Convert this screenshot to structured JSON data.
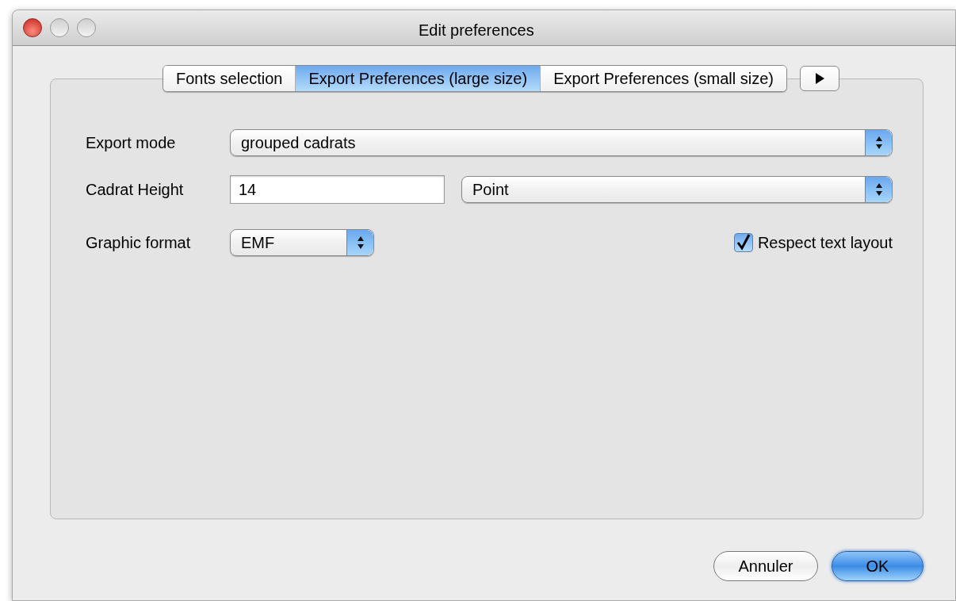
{
  "window": {
    "title": "Edit preferences"
  },
  "tabs": [
    {
      "label": "Fonts selection",
      "selected": false
    },
    {
      "label": "Export Preferences (large size)",
      "selected": true
    },
    {
      "label": "Export Preferences (small size)",
      "selected": false
    }
  ],
  "form": {
    "export_mode": {
      "label": "Export mode",
      "value": "grouped cadrats"
    },
    "cadrat_height": {
      "label": "Cadrat Height",
      "value": "14",
      "unit": "Point"
    },
    "graphic_format": {
      "label": "Graphic format",
      "value": "EMF"
    },
    "respect_text_layout": {
      "label": "Respect text layout",
      "checked": true
    }
  },
  "buttons": [
    {
      "label": "Annuler",
      "default": false
    },
    {
      "label": "OK",
      "default": true
    }
  ]
}
